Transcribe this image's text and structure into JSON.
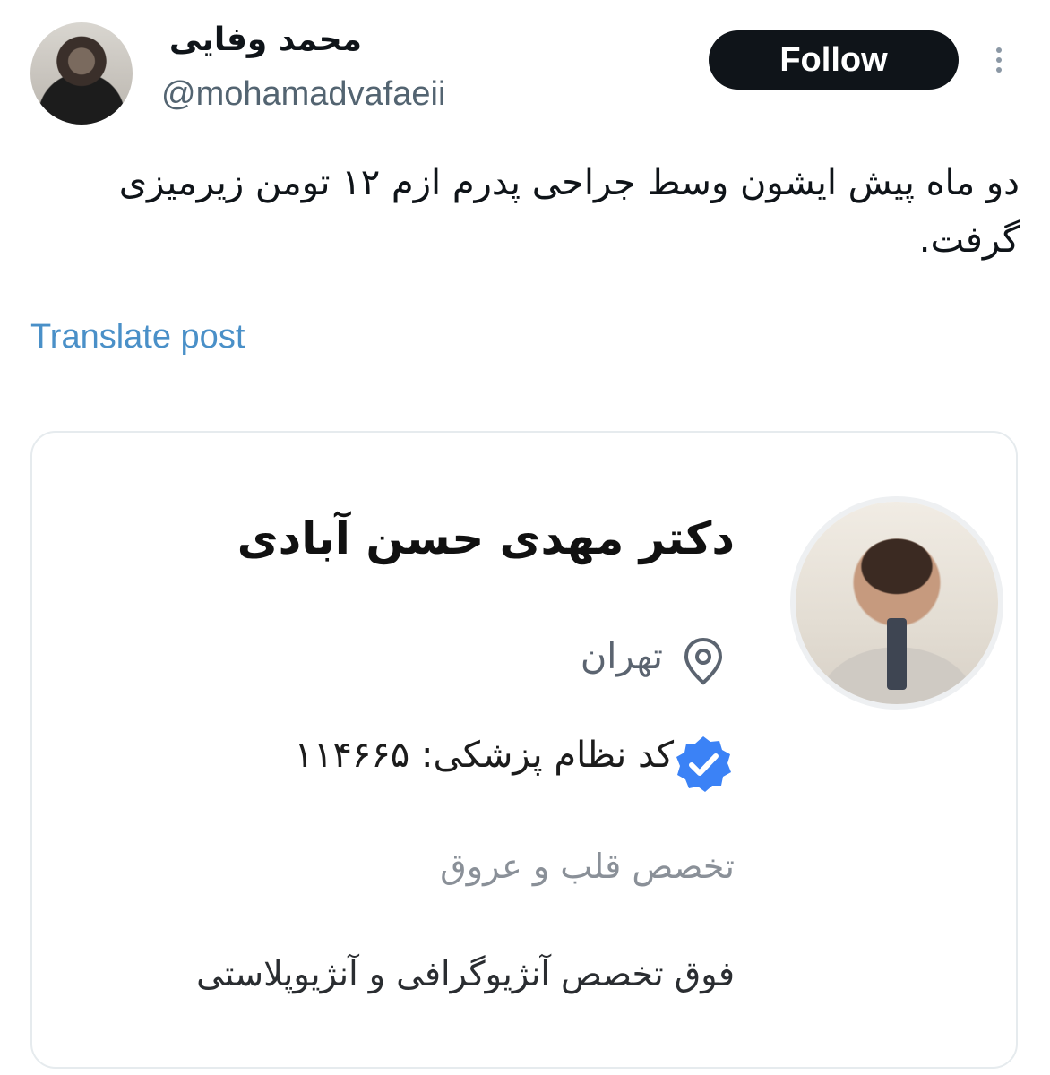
{
  "post": {
    "author": {
      "display_name": "محمد وفایی",
      "handle": "@mohamadvafaeii"
    },
    "follow_label": "Follow",
    "text": "دو ماه پیش ایشون وسط جراحی پدرم ازم ۱۲ تومن زیرمیزی گرفت.",
    "translate_label": "Translate post"
  },
  "card": {
    "doctor_name": "دکتر مهدی حسن آبادی",
    "location": "تهران",
    "medical_code": "کد نظام پزشکی: ۱۱۴۶۶۵",
    "specialty": "تخصص قلب و عروق",
    "subspecialty": "فوق تخصص آنژیوگرافی و آنژیوپلاستی"
  },
  "colors": {
    "link": "#4a90c8",
    "verified": "#3b82f6",
    "button_bg": "#0f1419"
  },
  "icons": [
    "more-icon",
    "location-pin-icon",
    "verified-badge-icon"
  ]
}
